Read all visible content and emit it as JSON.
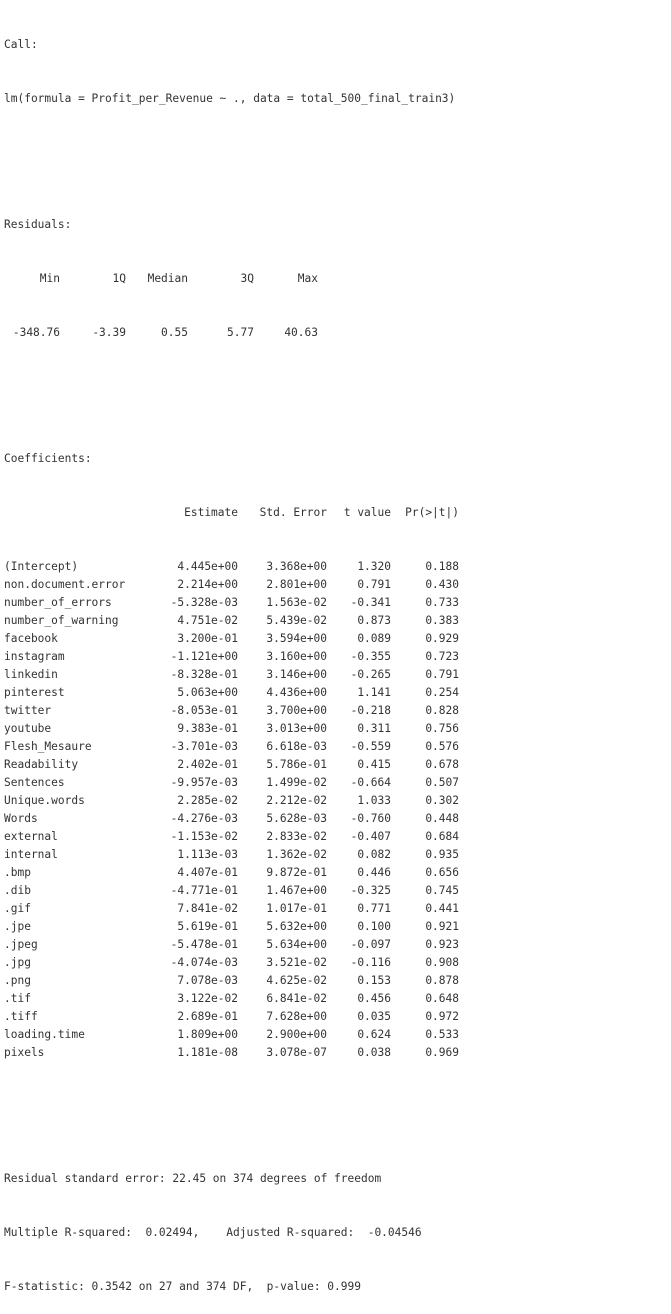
{
  "call": {
    "label": "Call:",
    "formula": "lm(formula = Profit_per_Revenue ~ ., data = total_500_final_train3)"
  },
  "residuals": {
    "label": "Residuals:",
    "headers": [
      "Min",
      "1Q",
      "Median",
      "3Q",
      "Max"
    ],
    "values": [
      "-348.76",
      "-3.39",
      "0.55",
      "5.77",
      "40.63"
    ]
  },
  "coefficients": {
    "label": "Coefficients:",
    "headers": [
      "Estimate",
      "Std. Error",
      "t value",
      "Pr(>|t|)"
    ],
    "rows": [
      {
        "term": "(Intercept)",
        "estimate": "4.445e+00",
        "se": "3.368e+00",
        "t": "1.320",
        "p": "0.188"
      },
      {
        "term": "non.document.error",
        "estimate": "2.214e+00",
        "se": "2.801e+00",
        "t": "0.791",
        "p": "0.430"
      },
      {
        "term": "number_of_errors",
        "estimate": "-5.328e-03",
        "se": "1.563e-02",
        "t": "-0.341",
        "p": "0.733"
      },
      {
        "term": "number_of_warning",
        "estimate": "4.751e-02",
        "se": "5.439e-02",
        "t": "0.873",
        "p": "0.383"
      },
      {
        "term": "facebook",
        "estimate": "3.200e-01",
        "se": "3.594e+00",
        "t": "0.089",
        "p": "0.929"
      },
      {
        "term": "instagram",
        "estimate": "-1.121e+00",
        "se": "3.160e+00",
        "t": "-0.355",
        "p": "0.723"
      },
      {
        "term": "linkedin",
        "estimate": "-8.328e-01",
        "se": "3.146e+00",
        "t": "-0.265",
        "p": "0.791"
      },
      {
        "term": "pinterest",
        "estimate": "5.063e+00",
        "se": "4.436e+00",
        "t": "1.141",
        "p": "0.254"
      },
      {
        "term": "twitter",
        "estimate": "-8.053e-01",
        "se": "3.700e+00",
        "t": "-0.218",
        "p": "0.828"
      },
      {
        "term": "youtube",
        "estimate": "9.383e-01",
        "se": "3.013e+00",
        "t": "0.311",
        "p": "0.756"
      },
      {
        "term": "Flesh_Mesaure",
        "estimate": "-3.701e-03",
        "se": "6.618e-03",
        "t": "-0.559",
        "p": "0.576"
      },
      {
        "term": "Readability",
        "estimate": "2.402e-01",
        "se": "5.786e-01",
        "t": "0.415",
        "p": "0.678"
      },
      {
        "term": "Sentences",
        "estimate": "-9.957e-03",
        "se": "1.499e-02",
        "t": "-0.664",
        "p": "0.507"
      },
      {
        "term": "Unique.words",
        "estimate": "2.285e-02",
        "se": "2.212e-02",
        "t": "1.033",
        "p": "0.302"
      },
      {
        "term": "Words",
        "estimate": "-4.276e-03",
        "se": "5.628e-03",
        "t": "-0.760",
        "p": "0.448"
      },
      {
        "term": "external",
        "estimate": "-1.153e-02",
        "se": "2.833e-02",
        "t": "-0.407",
        "p": "0.684"
      },
      {
        "term": "internal",
        "estimate": "1.113e-03",
        "se": "1.362e-02",
        "t": "0.082",
        "p": "0.935"
      },
      {
        "term": ".bmp",
        "estimate": "4.407e-01",
        "se": "9.872e-01",
        "t": "0.446",
        "p": "0.656"
      },
      {
        "term": ".dib",
        "estimate": "-4.771e-01",
        "se": "1.467e+00",
        "t": "-0.325",
        "p": "0.745"
      },
      {
        "term": ".gif",
        "estimate": "7.841e-02",
        "se": "1.017e-01",
        "t": "0.771",
        "p": "0.441"
      },
      {
        "term": ".jpe",
        "estimate": "5.619e-01",
        "se": "5.632e+00",
        "t": "0.100",
        "p": "0.921"
      },
      {
        "term": ".jpeg",
        "estimate": "-5.478e-01",
        "se": "5.634e+00",
        "t": "-0.097",
        "p": "0.923"
      },
      {
        "term": ".jpg",
        "estimate": "-4.074e-03",
        "se": "3.521e-02",
        "t": "-0.116",
        "p": "0.908"
      },
      {
        "term": ".png",
        "estimate": "7.078e-03",
        "se": "4.625e-02",
        "t": "0.153",
        "p": "0.878"
      },
      {
        "term": ".tif",
        "estimate": "3.122e-02",
        "se": "6.841e-02",
        "t": "0.456",
        "p": "0.648"
      },
      {
        "term": ".tiff",
        "estimate": "2.689e-01",
        "se": "7.628e+00",
        "t": "0.035",
        "p": "0.972"
      },
      {
        "term": "loading.time",
        "estimate": "1.809e+00",
        "se": "2.900e+00",
        "t": "0.624",
        "p": "0.533"
      },
      {
        "term": "pixels",
        "estimate": "1.181e-08",
        "se": "3.078e-07",
        "t": "0.038",
        "p": "0.969"
      }
    ]
  },
  "summary": {
    "rse": "Residual standard error: 22.45 on 374 degrees of freedom",
    "r2": "Multiple R-squared:  0.02494,    Adjusted R-squared:  -0.04546",
    "fstat": "F-statistic: 0.3542 on 27 and 374 DF,  p-value: 0.999"
  },
  "colors": {
    "text": "#333333",
    "background": "#ffffff"
  }
}
